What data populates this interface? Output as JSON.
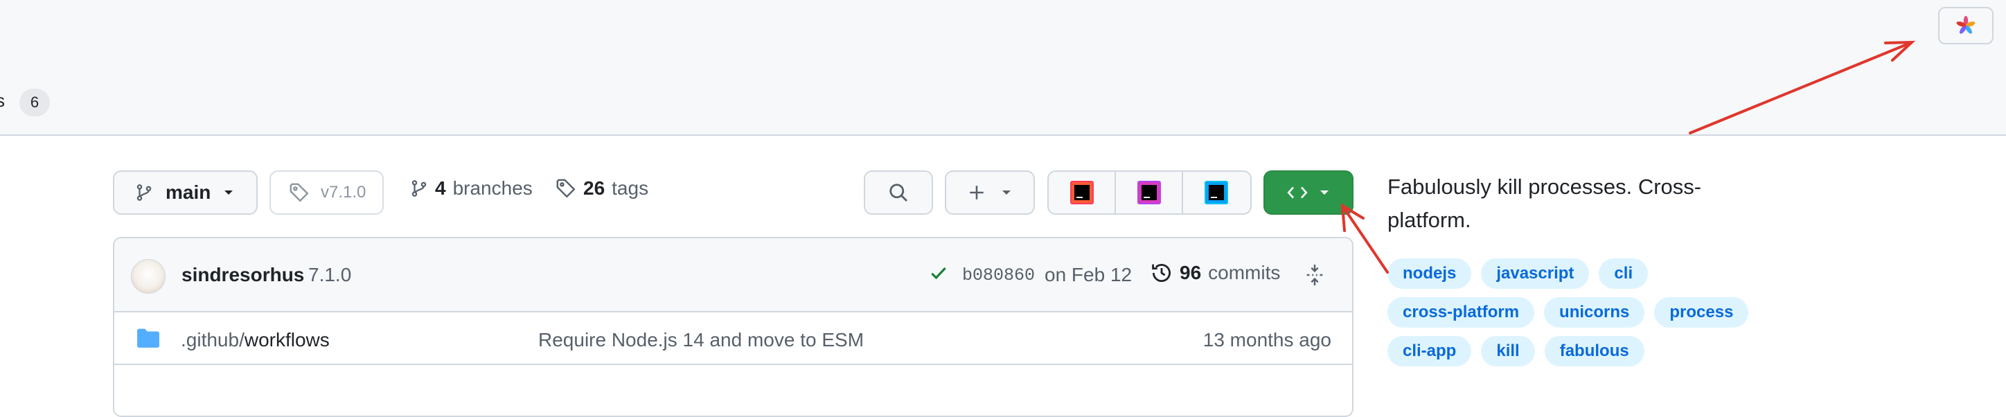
{
  "top": {
    "tab_partial": "s",
    "tab_count": "6",
    "extension_icon": "pinwheel-icon"
  },
  "repo_nav": {
    "branch_label": "main",
    "tag_label": "v7.1.0",
    "branches_count": "4",
    "branches_label": "branches",
    "tags_count": "26",
    "tags_label": "tags"
  },
  "ide_icons": [
    "intellij-icon",
    "phpstorm-icon",
    "webstorm-icon"
  ],
  "commit": {
    "author": "sindresorhus",
    "message": "7.1.0",
    "sha": "b080860",
    "date": "on Feb 12",
    "commits_count": "96",
    "commits_label": "commits"
  },
  "files": [
    {
      "name_dim": ".github/",
      "name_main": "workflows",
      "commit_message": "Require Node.js 14 and move to ESM",
      "age": "13 months ago"
    }
  ],
  "about": {
    "description": "Fabulously kill processes. Cross-platform.",
    "topics": [
      "nodejs",
      "javascript",
      "cli",
      "cross-platform",
      "unicorns",
      "process",
      "cli-app",
      "kill",
      "fabulous"
    ]
  },
  "colors": {
    "code_button": "#2c974b",
    "topic_bg": "#ddf4ff",
    "topic_text": "#0969da",
    "annotation_arrow": "#e0362c"
  }
}
